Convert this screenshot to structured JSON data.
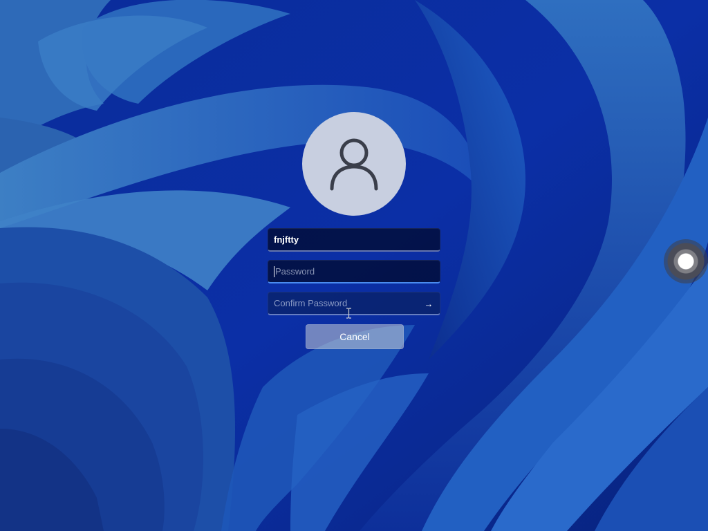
{
  "login": {
    "username": "fnjftty",
    "password_placeholder": "Password",
    "confirm_placeholder": "Confirm Password",
    "cancel_label": "Cancel",
    "submit_icon": "arrow-right-icon",
    "avatar_icon": "user-icon"
  },
  "colors": {
    "background": "#0b2fa3",
    "avatar_bg": "#c8cfe0",
    "focus_accent": "#4a8cf0"
  }
}
